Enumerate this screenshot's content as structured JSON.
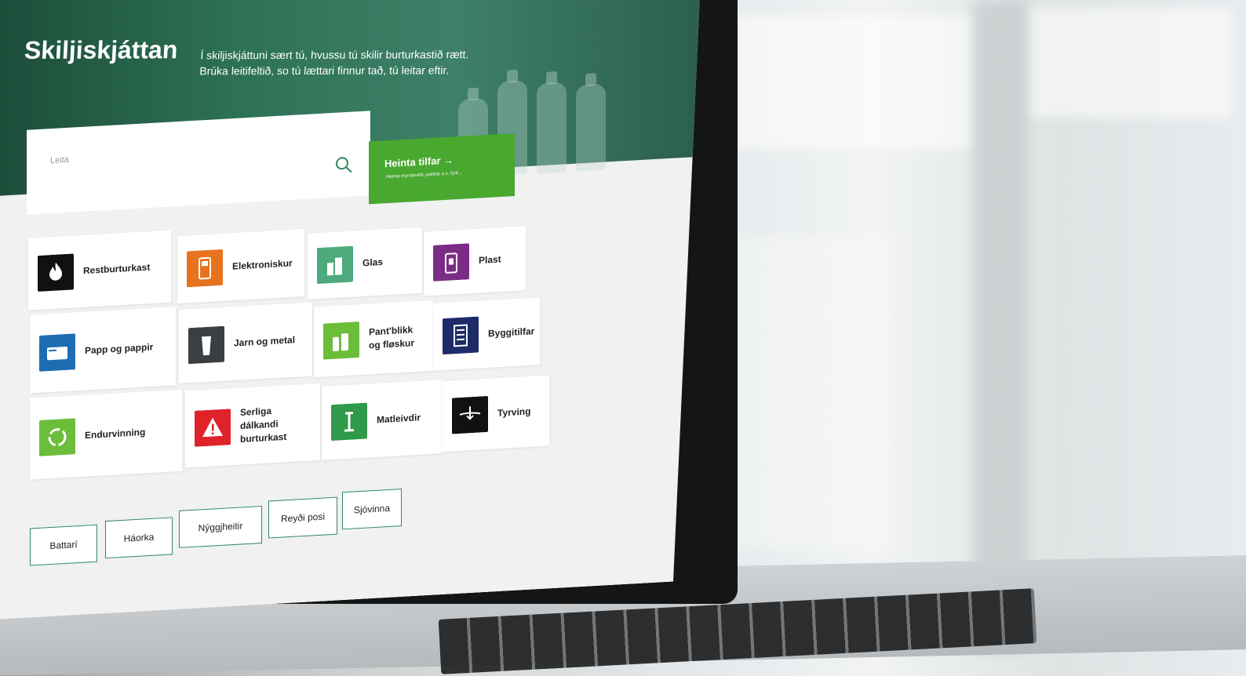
{
  "site": {
    "title": "Skiljiskjáttan",
    "intro": "Í skiljiskjáttuni sært tú, hvussu tú skilir burturkastið rætt. Brúka leitifeltið, so tú lættari finnur tað, tú leitar eftir."
  },
  "search": {
    "placeholder": "Leita"
  },
  "cta": {
    "title": "Heinta tilfar →",
    "subtitle": "Heinta myndavélir, pakkar o.s. fyrir..."
  },
  "categories": [
    {
      "label": "Restburturkast",
      "icon": "flame-icon",
      "color": "#111111"
    },
    {
      "label": "Elektroniskur",
      "icon": "electronics-icon",
      "color": "#e8731e"
    },
    {
      "label": "Glas",
      "icon": "glass-bottles-icon",
      "color": "#4daa7c"
    },
    {
      "label": "Plast",
      "icon": "plastic-icon",
      "color": "#7b2c86"
    },
    {
      "label": "Papp og pappir",
      "icon": "paper-icon",
      "color": "#1e6db3"
    },
    {
      "label": "Jarn og metal",
      "icon": "metal-can-icon",
      "color": "#3b3f41"
    },
    {
      "label": "Pant'blikk og fløskur",
      "icon": "deposit-bottles-icon",
      "color": "#6cbd3a"
    },
    {
      "label": "Byggitilfar",
      "icon": "building-material-icon",
      "color": "#1d2b69"
    },
    {
      "label": "Endurvinning",
      "icon": "recycle-icon",
      "color": "#6cbd3a"
    },
    {
      "label": "Serliga dálkandi burturkast",
      "icon": "hazard-icon",
      "color": "#e0222a"
    },
    {
      "label": "Matleivdir",
      "icon": "food-waste-icon",
      "color": "#2f9a4a"
    },
    {
      "label": "Tyrving",
      "icon": "compost-icon",
      "color": "#111111"
    }
  ],
  "chips": [
    "Battarí",
    "Háorka",
    "Nýggjheitir",
    "Reyði posi",
    "Sjóvinna"
  ]
}
